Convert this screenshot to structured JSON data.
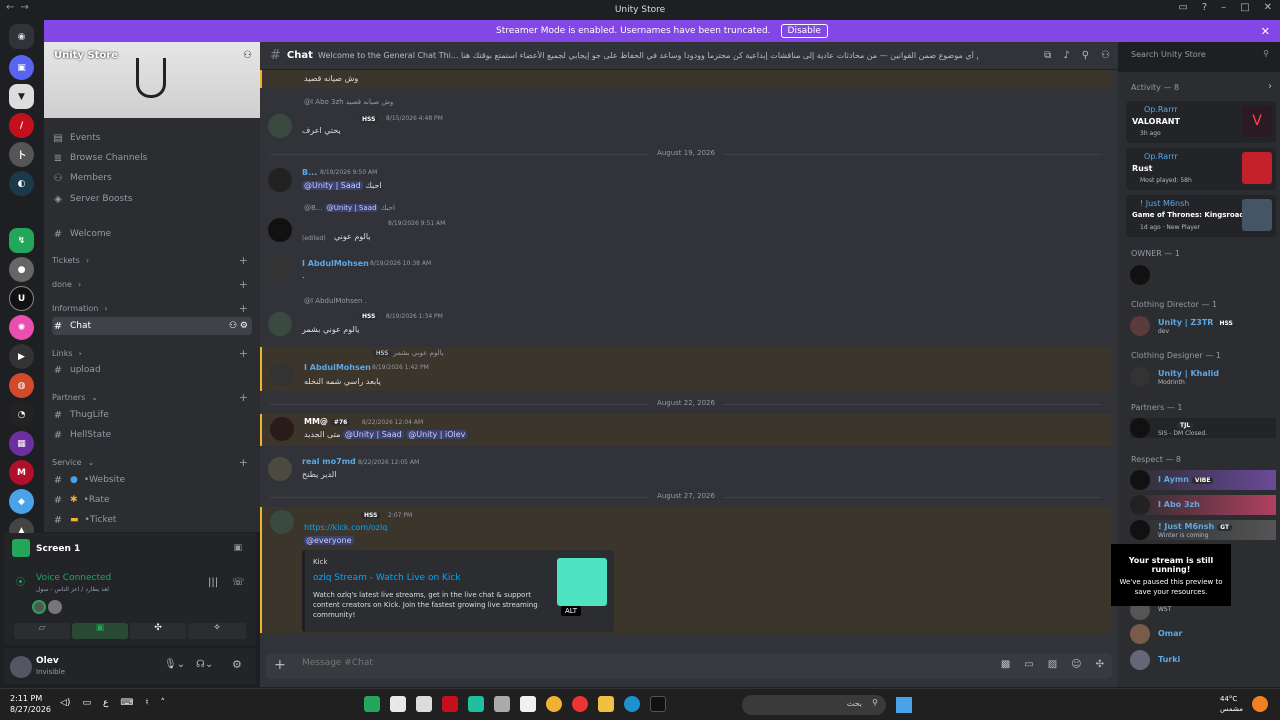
{
  "window": {
    "title": "Unity Store"
  },
  "banner": {
    "text": "Streamer Mode is enabled. Usernames have been truncated.",
    "button": "Disable"
  },
  "server": {
    "name": "Unity Store"
  },
  "channels": {
    "top": [
      {
        "icon": "calendar-icon",
        "label": "Events"
      },
      {
        "icon": "browse-icon",
        "label": "Browse Channels"
      },
      {
        "icon": "members-icon",
        "label": "Members"
      },
      {
        "icon": "boost-icon",
        "label": "Server Boosts"
      }
    ],
    "welcome": "Welcome",
    "cat_tickets": "Tickets",
    "cat_done": "done",
    "cat_information": "Information",
    "chat": "Chat",
    "cat_links": "Links",
    "upload": "upload",
    "cat_partners": "Partners",
    "thuglife": "ThugLife",
    "hellstate": "HellState",
    "cat_service": "Service",
    "website": "•Website",
    "rate": "•Rate",
    "ticket": "•Ticket"
  },
  "voice": {
    "screen": "Screen 1",
    "status": "Voice Connected",
    "sub": "لعد يطارد / اعز الناس - سول"
  },
  "user": {
    "name": "Olev",
    "status": "Invisible"
  },
  "chat_header": {
    "name": "Chat",
    "topic": "Welcome to the General Chat Thi... هذا المكان للتواصل والمشاركة مع الجميع يمكنك التحدث عن أي موضوع ضمن القوانين — من محادثات عادية إلى مناقشات إبداعية كن محترماً وودوداً وساعد في الحفاظ على جو إيجابي لجميع الأعضاء استمتع بوقتك هنا"
  },
  "search": {
    "placeholder": "Search Unity Store"
  },
  "messages": {
    "top_line": "وش صيانه قصيد",
    "m1": {
      "reply_author": "@I Abo 3zh",
      "reply_text": "وش صيانه قصيد",
      "tag": "HSS",
      "time": "8/15/2026 4:48 PM",
      "text": "يحتي اعرف"
    },
    "d1": "August 19, 2026",
    "m2": {
      "author": "B...",
      "time": "8/19/2026 9:50 AM",
      "text": "احبك",
      "mention": "@Unity | Saad"
    },
    "m3": {
      "reply_author": "@B...",
      "reply_mention": "@Unity | Saad",
      "reply_text": "احبك",
      "time": "8/19/2026 9:51 AM",
      "edited": "(edited)",
      "text": "يالوم عوني"
    },
    "m4": {
      "author": "I AbdulMohsen",
      "time": "8/19/2026 10:38 AM",
      "text": "."
    },
    "m5": {
      "reply_author": "@I AbdulMohsen",
      "reply_text": ".",
      "tag": "HSS",
      "time": "8/19/2026 1:34 PM",
      "text": "يالوم عوني بشمر"
    },
    "m6": {
      "reply_text": "يالوم عوني بشمر",
      "tag": "HSS",
      "author": "I AbdulMohsen",
      "time": "8/19/2026 1:42 PM",
      "text": "يابعد راسي شمه النخله"
    },
    "d2": "August 22, 2026",
    "m7": {
      "author": "MM@",
      "tag": "#76",
      "time": "8/22/2026 12:04 AM",
      "text": "متى الجديد",
      "mention1": "@Unity | Saad",
      "mention2": "@Unity | iOlev"
    },
    "m8": {
      "author": "real mo7md",
      "time": "8/22/2026 12:05 AM",
      "text": "الدير يطنح"
    },
    "d3": "August 27, 2026",
    "m9": {
      "tag": "HSS",
      "time": "2:07 PM",
      "link": "https://kick.com/ozlq",
      "mention": "@everyone"
    }
  },
  "embed": {
    "provider": "Kick",
    "title": "ozlq Stream - Watch Live on Kick",
    "desc": "Watch ozlq's latest live streams, get in the live chat & support content creators on Kick. Join the fastest growing live streaming community!",
    "alt": "ALT"
  },
  "composer": {
    "placeholder": "Message #Chat"
  },
  "members": {
    "activity": "Activity — 8",
    "cards": [
      {
        "name": "Op.Rarrr",
        "game": "VALORANT",
        "sub": "3h ago"
      },
      {
        "name": "Op.Rarrr",
        "game": "Rust",
        "sub": "Most played: 58h"
      },
      {
        "name": "! Just M6nsh",
        "game": "Game of Thrones: Kingsroad",
        "sub": "1d ago · New Player"
      }
    ],
    "owner": "OWNER — 1",
    "clothing_director": "Clothing Director — 1",
    "z3tr": "Unity | Z3TR",
    "z3tr_tag": "HSS",
    "z3tr_sub": "dev",
    "clothing_designer": "Clothing Designer — 1",
    "khalid": "Unity | Khalid",
    "khalid_sub": "Modrinth",
    "partners": "Partners — 1",
    "partner_tag": "TJL",
    "partner_sub": "SIS - DM Closed.",
    "respect": "Respect — 8",
    "aymn": "I Aymn",
    "aymn_tag": "VIBE",
    "abo3zh": "I Abo 3zh",
    "m6nsh": "! Just M6nsh",
    "m6nsh_tag": "GT",
    "m6nsh_sub": "Winter is coming",
    "wst": "WST",
    "omar": "Omar",
    "turki": "Turki"
  },
  "toast": {
    "title": "Your stream is still running!",
    "text": "We've paused this preview to save your resources."
  },
  "taskbar": {
    "time": "2:11 PM",
    "date": "8/27/2026",
    "search": "بحث",
    "temp": "44°C",
    "weather": "مشمس",
    "lang": "ع"
  }
}
